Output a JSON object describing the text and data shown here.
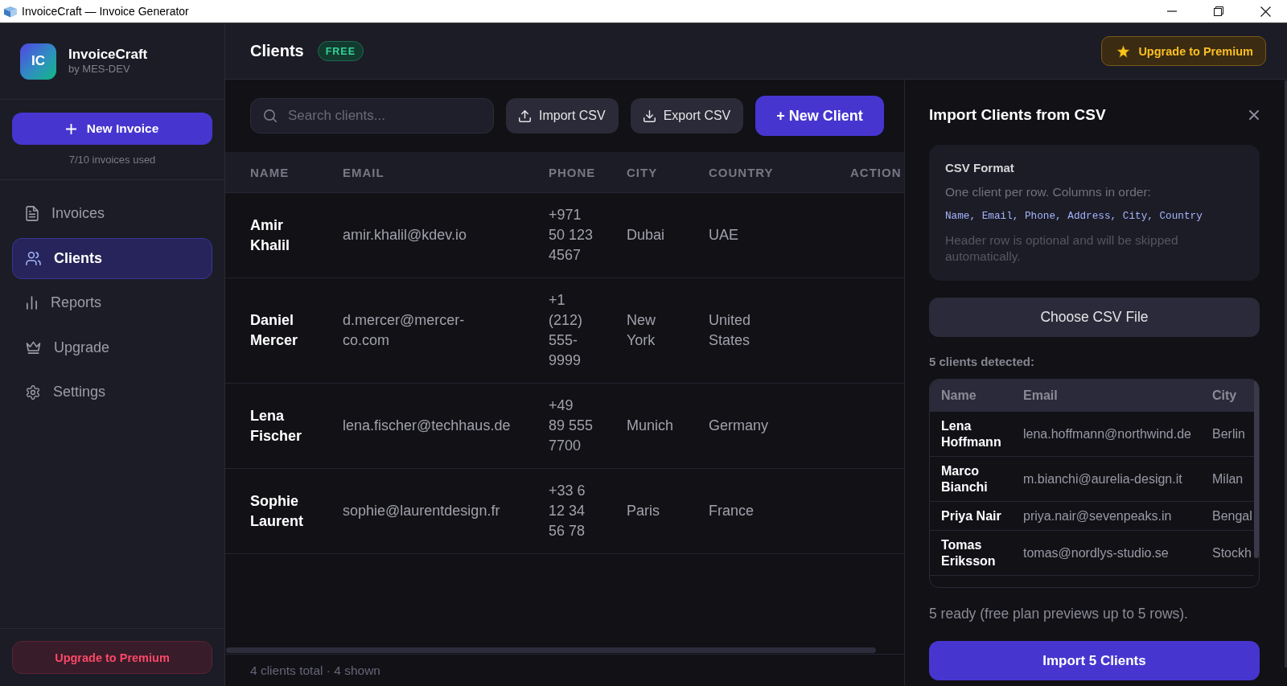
{
  "window": {
    "title": "InvoiceCraft — Invoice Generator"
  },
  "sidebar": {
    "logo": {
      "initials": "IC",
      "name": "InvoiceCraft",
      "byline": "by MES-DEV"
    },
    "new_invoice_button": "New Invoice",
    "usage": "7/10 invoices used",
    "items": [
      {
        "label": "Invoices",
        "selected": false
      },
      {
        "label": "Clients",
        "selected": true
      },
      {
        "label": "Reports",
        "selected": false
      },
      {
        "label": "Upgrade",
        "selected": false
      },
      {
        "label": "Settings",
        "selected": false
      }
    ],
    "upgrade_button": "Upgrade to Premium"
  },
  "header": {
    "title": "Clients",
    "badge": "FREE",
    "upgrade_button": "Upgrade to Premium"
  },
  "toolbar": {
    "search": {
      "placeholder": "Search clients..."
    },
    "buttons": [
      {
        "label": "Import CSV",
        "kind": "secondary"
      },
      {
        "label": "Export CSV",
        "kind": "secondary"
      },
      {
        "label": "+ New Client",
        "kind": "primary"
      }
    ]
  },
  "table": {
    "columns": [
      "NAME",
      "EMAIL",
      "PHONE",
      "CITY",
      "COUNTRY",
      "ACTION"
    ],
    "rows": [
      {
        "name": "Amir Khalil",
        "email": "amir.khalil@kdev.io",
        "phone": "+971 50 123 4567",
        "city": "Dubai",
        "country": "UAE"
      },
      {
        "name": "Daniel Mercer",
        "email": "d.mercer@mercer-co.com",
        "phone": "+1 (212) 555-9999",
        "city": "New York",
        "country": "United States"
      },
      {
        "name": "Lena Fischer",
        "email": "lena.fischer@techhaus.de",
        "phone": "+49 89 555 7700",
        "city": "Munich",
        "country": "Germany"
      },
      {
        "name": "Sophie Laurent",
        "email": "sophie@laurentdesign.fr",
        "phone": "+33 6 12 34 56 78",
        "city": "Paris",
        "country": "France"
      }
    ]
  },
  "status_bar": "4 clients total · 4 shown",
  "import_panel": {
    "title": "Import Clients from CSV",
    "format": {
      "heading": "CSV Format",
      "description": "One client per row. Columns in order:",
      "columns": "Name, Email, Phone, Address, City, Country",
      "note": "Header row is optional and will be skipped automatically."
    },
    "choose_button": "Choose CSV File",
    "detected": "5 clients detected:",
    "preview": {
      "columns": [
        "Name",
        "Email",
        "City"
      ],
      "rows": [
        {
          "name": "Lena Hoffmann",
          "email": "lena.hoffmann@northwind.de",
          "city": "Berlin"
        },
        {
          "name": "Marco Bianchi",
          "email": "m.bianchi@aurelia-design.it",
          "city": "Milan"
        },
        {
          "name": "Priya Nair",
          "email": "priya.nair@sevenpeaks.in",
          "city": "Bengal"
        },
        {
          "name": "Tomas Eriksson",
          "email": "tomas@nordlys-studio.se",
          "city": "Stockh"
        }
      ]
    },
    "summary": "5 ready (free plan previews up to 5 rows).",
    "import_button": "Import 5 Clients"
  }
}
